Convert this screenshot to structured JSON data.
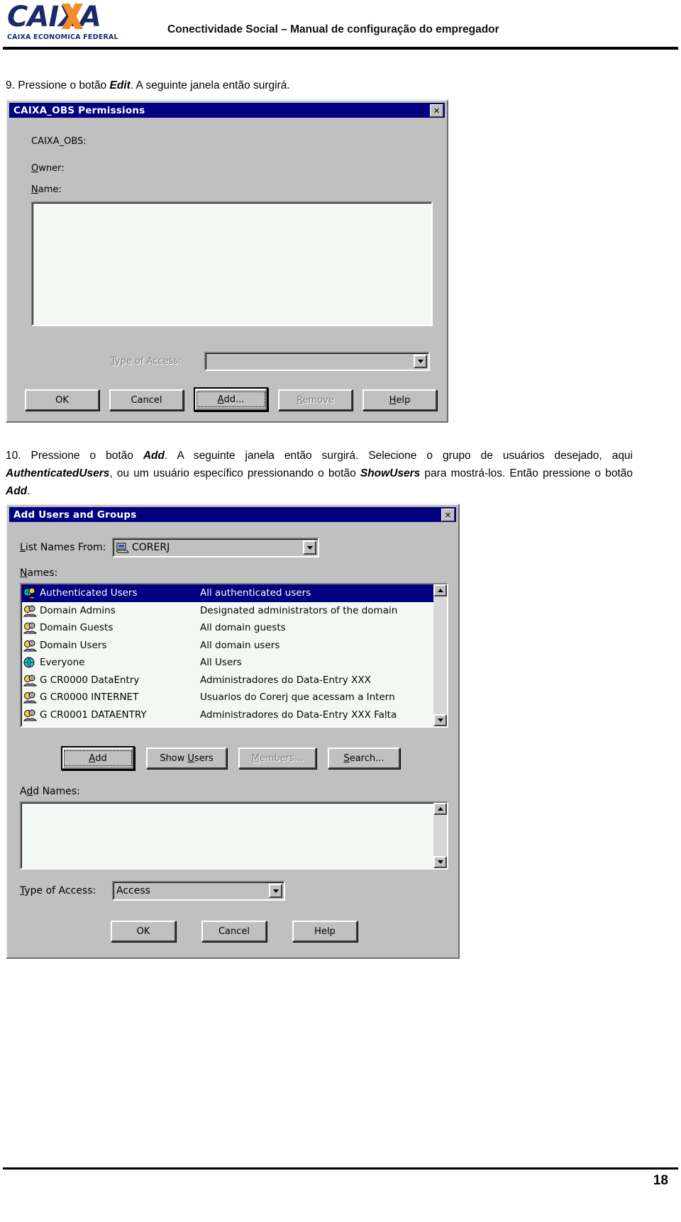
{
  "header": {
    "logo_main": "CAIXA",
    "logo_sub": "CAIXA ECONOMICA FEDERAL",
    "title": "Conectividade Social – Manual de configuração do empregador"
  },
  "steps": {
    "step9_pre": "9. Pressione o botão ",
    "step9_em": "Edit",
    "step9_post": ". A seguinte janela então surgirá.",
    "step10_a": "10. Pressione o botão ",
    "step10_em1": "Add",
    "step10_b": ". A seguinte janela então surgirá. Selecione o grupo de usuários desejado, aqui ",
    "step10_em2": "AuthenticatedUsers",
    "step10_c": ", ou um usuário específico pressionando o botão ",
    "step10_em3": "ShowUsers",
    "step10_d": " para mostrá-los. Então pressione o botão ",
    "step10_em4": "Add",
    "step10_e": "."
  },
  "permissions_dialog": {
    "title": "CAIXA_OBS Permissions",
    "close_glyph": "✕",
    "object_label": "CAIXA_OBS:",
    "owner_label": "Owner:",
    "owner_accel": "O",
    "name_label": "Name:",
    "name_accel": "N",
    "names_list": [],
    "type_of_access_label": "Type of Access:",
    "type_of_access_accel": "T",
    "type_of_access_value": "",
    "buttons": [
      {
        "label": "OK",
        "accel": "",
        "state": "normal"
      },
      {
        "label": "Cancel",
        "accel": "",
        "state": "normal"
      },
      {
        "label": "Add...",
        "accel": "A",
        "state": "default"
      },
      {
        "label": "Remove",
        "accel": "R",
        "state": "disabled"
      },
      {
        "label": "Help",
        "accel": "H",
        "state": "normal"
      }
    ]
  },
  "add_users_dialog": {
    "title": "Add Users and Groups",
    "close_glyph": "✕",
    "list_names_from_label": "List Names From:",
    "list_names_from_accel": "L",
    "domain_value": "CORERJ",
    "domain_icon": "computer-icon",
    "names_label": "Names:",
    "names_accel": "N",
    "names_rows": [
      {
        "name": "Authenticated Users",
        "desc": "All authenticated users",
        "icon": "globe-group-icon",
        "selected": true
      },
      {
        "name": "Domain Admins",
        "desc": "Designated administrators of the domain",
        "icon": "group-icon",
        "selected": false
      },
      {
        "name": "Domain Guests",
        "desc": "All domain guests",
        "icon": "group-icon",
        "selected": false
      },
      {
        "name": "Domain Users",
        "desc": "All domain users",
        "icon": "group-icon",
        "selected": false
      },
      {
        "name": "Everyone",
        "desc": "All Users",
        "icon": "globe-icon",
        "selected": false
      },
      {
        "name": "G CR0000 DataEntry",
        "desc": "Administradores do Data-Entry XXX",
        "icon": "group-icon",
        "selected": false
      },
      {
        "name": "G CR0000 INTERNET",
        "desc": "Usuarios do Corerj que acessam a Intern",
        "icon": "group-icon",
        "selected": false
      },
      {
        "name": "G CR0001 DATAENTRY",
        "desc": "Administradores do Data-Entry XXX Falta",
        "icon": "group-icon",
        "selected": false
      }
    ],
    "buttons": [
      {
        "label": "Add",
        "accel": "A",
        "state": "default"
      },
      {
        "label": "Show Users",
        "accel": "U",
        "state": "normal"
      },
      {
        "label": "Members...",
        "accel": "M",
        "state": "disabled"
      },
      {
        "label": "Search...",
        "accel": "S",
        "state": "normal"
      }
    ],
    "add_names_label": "Add Names:",
    "add_names_accel": "d",
    "add_names_value": "",
    "type_of_access_label": "Type of Access:",
    "type_of_access_accel": "T",
    "type_of_access_value": "Access",
    "footer_buttons": [
      {
        "label": "OK",
        "state": "normal"
      },
      {
        "label": "Cancel",
        "state": "normal"
      },
      {
        "label": "Help",
        "state": "normal"
      }
    ]
  },
  "footer": {
    "page_number": "18"
  },
  "colors": {
    "titlebar": "#000080",
    "dialog_face": "#c0c0c0",
    "logo_blue": "#1b2a6b",
    "logo_orange": "#f28b28",
    "selection": "#000080"
  }
}
